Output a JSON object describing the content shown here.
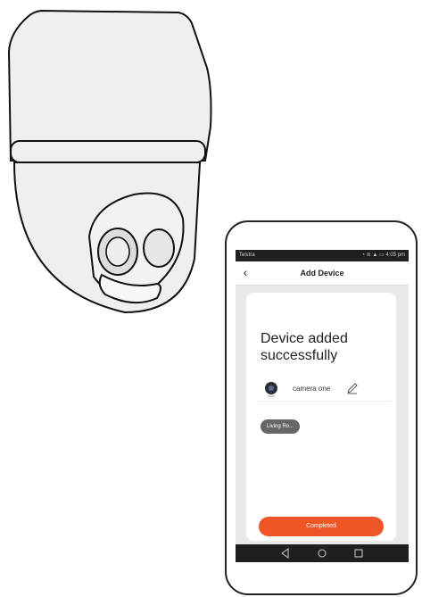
{
  "status_bar": {
    "carrier": "Telstra",
    "time": "4:03 pm"
  },
  "header": {
    "title": "Add Device"
  },
  "card": {
    "title": "Device added successfully",
    "device_name": "camera one",
    "room_chip": "Living Ro...",
    "complete_label": "Completed"
  },
  "icons": {
    "back": "chevron-left-icon",
    "device": "camera-icon",
    "edit": "pencil-icon",
    "nav_back": "triangle-back-icon",
    "nav_home": "circle-home-icon",
    "nav_recents": "square-recents-icon"
  },
  "colors": {
    "accent": "#f05527",
    "chip": "#666666",
    "screen_bg": "#e9e9e9",
    "system_bars": "#1f1f1f"
  }
}
